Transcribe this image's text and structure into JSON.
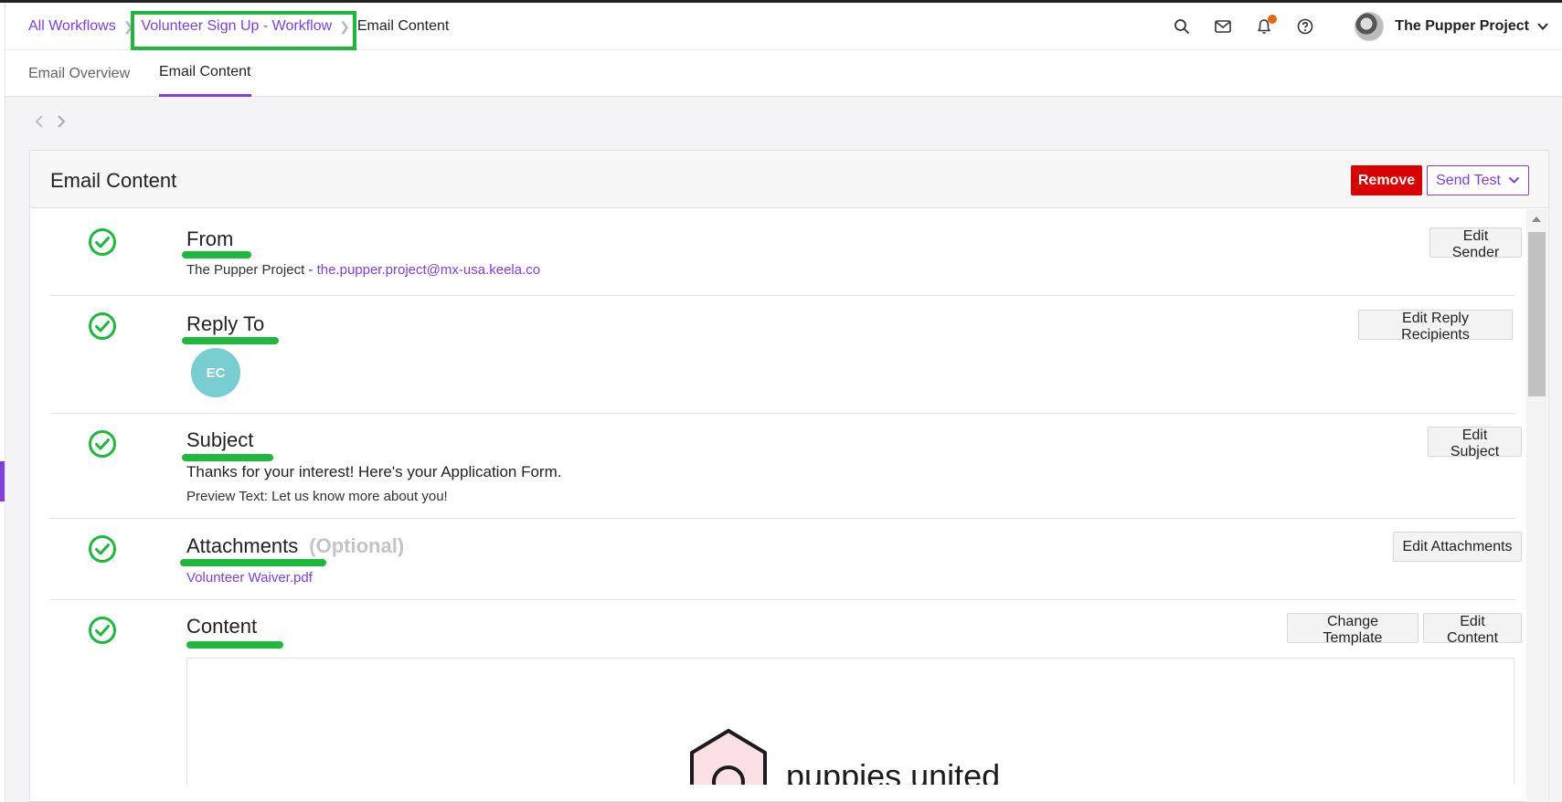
{
  "breadcrumb": {
    "root": "All Workflows",
    "workflow": "Volunteer Sign Up - Workflow",
    "current": "Email Content"
  },
  "header": {
    "icons": [
      "search-icon",
      "mail-icon",
      "bell-icon",
      "help-icon"
    ],
    "account_name": "The Pupper Project"
  },
  "tabs": [
    {
      "label": "Email Overview",
      "active": false
    },
    {
      "label": "Email Content",
      "active": true
    }
  ],
  "panel": {
    "title": "Email Content",
    "remove_label": "Remove",
    "send_test_label": "Send Test"
  },
  "sections": {
    "from": {
      "title": "From",
      "sender_name": "The Pupper Project - ",
      "sender_email": "the.pupper.project@mx-usa.keela.co",
      "button": "Edit Sender"
    },
    "reply_to": {
      "title": "Reply To",
      "recipient_initials": "EC",
      "button": "Edit Reply Recipients"
    },
    "subject": {
      "title": "Subject",
      "subject_text": "Thanks for your interest! Here's your Application Form.",
      "preview_text": "Preview Text: Let us know more about you!",
      "button": "Edit Subject"
    },
    "attachments": {
      "title": "Attachments",
      "optional": "(Optional)",
      "file": "Volunteer Waiver.pdf",
      "button": "Edit Attachments"
    },
    "content": {
      "title": "Content",
      "change_template": "Change Template",
      "edit_content": "Edit Content",
      "logo_text": "puppies united"
    }
  },
  "colors": {
    "accent": "#7b3fe4",
    "success": "#1db83c",
    "danger": "#d90000",
    "avatar_teal": "#78cdd1"
  }
}
